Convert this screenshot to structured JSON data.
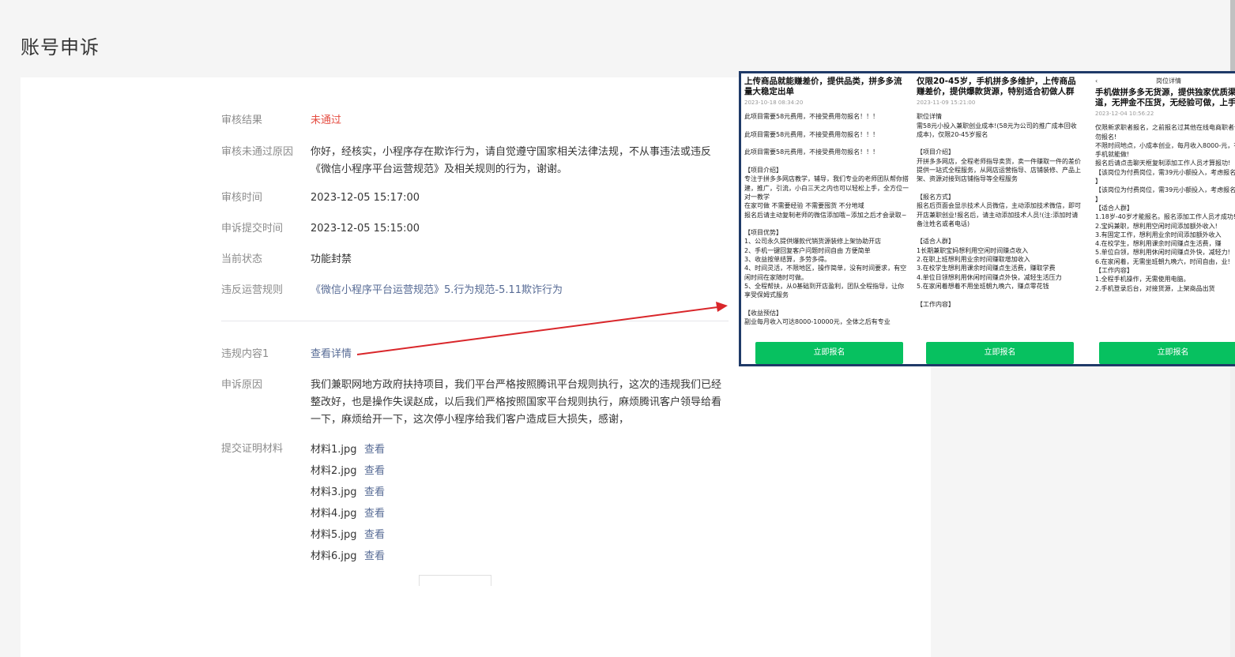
{
  "page_title": "账号申诉",
  "fields": {
    "review_result": {
      "label": "审核结果",
      "value": "未通过"
    },
    "reject_reason": {
      "label": "审核未通过原因",
      "value": "你好，经核实，小程序存在欺诈行为，请自觉遵守国家相关法律法规，不从事违法或违反《微信小程序平台运营规范》及相关规则的行为，谢谢。"
    },
    "review_time": {
      "label": "审核时间",
      "value": "2023-12-05 15:17:00"
    },
    "submit_time": {
      "label": "申诉提交时间",
      "value": "2023-12-05 15:15:00"
    },
    "current_status": {
      "label": "当前状态",
      "value": "功能封禁"
    },
    "violated_rule": {
      "label": "违反运营规则",
      "value": "《微信小程序平台运营规范》5.行为规范-5.11欺诈行为"
    },
    "violation_content": {
      "label": "违规内容1",
      "value": "查看详情"
    },
    "appeal_reason": {
      "label": "申诉原因",
      "value": "我们兼职网地方政府扶持项目，我们平台严格按照腾讯平台规则执行，这次的违规我们已经整改好，也是操作失误赵成，以后我们严格按照国家平台规则执行，麻烦腾讯客户领导给看一下，麻烦给开一下，这次停小程序给我们客户造成巨大损失，感谢，"
    },
    "materials": {
      "label": "提交证明材料",
      "view_label": "查看",
      "files": [
        "材料1.jpg",
        "材料2.jpg",
        "材料3.jpg",
        "材料4.jpg",
        "材料5.jpg",
        "材料6.jpg"
      ]
    }
  },
  "evidence": {
    "panel1": {
      "title": "上传商品就能赚差价，提供品类，拼多多流量大稳定出单",
      "date": "2023-10-18 08:34:20",
      "body": "此项目需要58元费用，不接受费用勿报名！！！\n\n此项目需要58元费用，不接受费用勿报名！！！\n\n此项目需要58元费用，不接受费用勿报名！！！\n\n【项目介绍】\n专注于拼多多网店教学，辅导，我们专业的老师团队帮你搭建，推广，引流，小白三天之内也可以轻松上手，全方位一对一教学\n在家可做 不需要经验 不需要囤货 不分地域\n报名后请主动复制老师的微信添加哦~添加之后才会录取~\n\n【项目优势】\n1、公司永久提供爆款代销货源装修上架协助开店\n2、手机一键回复客户问题时间自由 方便简单\n3、收益按单结算，多劳多得。\n4、时间灵活，不限地区，操作简单，没有时间要求，有空闲时间在家随时可做。\n5、全程帮扶，从0基础到开店盈利，团队全程指导，让你享受保姆式服务\n\n【收益预估】\n副业每月收入可达8000-10000元，全体之后有专业",
      "button": "立即报名"
    },
    "panel2": {
      "title": "仅限20-45岁，手机拼多多维护，上传商品赚差价，提供爆款货源，特别适合初做人群",
      "date": "2023-11-09 15:21:00",
      "body": "职位详情\n需58元小投入兼职创业成本!(58元为公司的推广成本回收成本)，仅限20-45岁报名\n\n【项目介绍】\n开拼多多网店，全程老师指导卖货，卖一件赚取一件的差价\n提供一站式全程服务，从网店运营指导、店铺装修、产品上架、资源对接到店铺指导等全程服务\n\n【报名方式】\n报名后页面会显示技术人员微信，主动添加技术微信，即可开店兼职创业!报名后，请主动添加技术人员!(注:添加时请备注姓名或者电话)\n\n【适合人群】\n1长期兼职宝妈想利用空闲时间赚点收入\n2.在职上班想利用业余时间赚取增加收入\n3.在校学生想利用课余时间赚点生活费，赚取学费\n4.单位日领想利用休闲时间赚点外快，减轻生活压力\n5.在家闲着想着不用坐班朝九晚六，赚点零花钱\n\n【工作内容】",
      "button": "立即报名"
    },
    "panel3": {
      "top_title": "岗位详情",
      "title": "手机做拼多多无货源，提供独家优质渠道，无押金不压货，无经验可做，上手",
      "date": "2023-12-04 10:56:22",
      "body": "仅限新求职者报名，之前报名过其他在线电商职者请勿报名!\n不限时间地点，小成本创业，每月收入8000-元，有手机就能做!\n报名后请点击聊天框复制添加工作人员才算报功!\n【该岗位为付费岗位，需39元小额投入，考虑报名!!! 】\n【该岗位为付费岗位，需39元小额投入，考虑报名!!! 】\n【适合人群】\n1.18岁-40岁才能报名。报名添加工作人员才成功!\n2.宝妈兼职，想利用空闲时间添加额外收入!\n3.有固定工作，想利用业余时间添加额外收入\n4.在校学生，想利用课余时间赚点生活费，赚\n5.单位白领，想利用休闲时间赚点外快，减轻力!\n6.在家闲着，无需坐班朝九晚六，时间自由，业!\n【工作内容】\n1.全程手机操作，无需使用电脑。\n2.手机登录后台，对接货源，上架商品出货",
      "button": "立即报名"
    }
  }
}
